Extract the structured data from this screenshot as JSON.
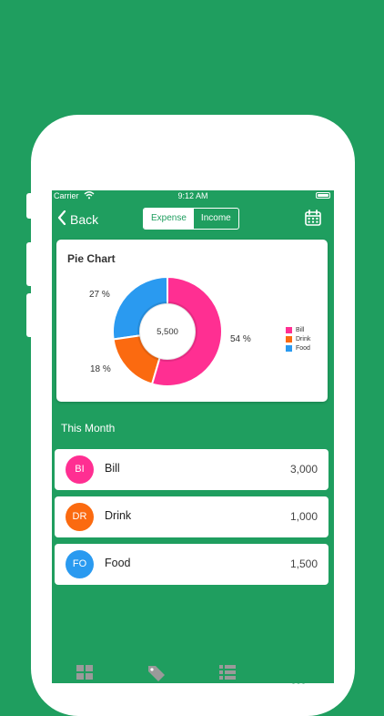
{
  "status_bar": {
    "carrier": "Carrier",
    "time": "9:12 AM"
  },
  "nav": {
    "back_label": "Back",
    "segments": [
      {
        "label": "Expense",
        "active": true
      },
      {
        "label": "Income",
        "active": false
      }
    ],
    "calendar_icon": "calendar-icon"
  },
  "pie_card": {
    "title": "Pie Chart",
    "center_total": "5,500"
  },
  "chart_data": {
    "type": "pie",
    "title": "Pie Chart",
    "categories": [
      "Bill",
      "Drink",
      "Food"
    ],
    "values": [
      3000,
      1000,
      1500
    ],
    "percent_labels": [
      "54 %",
      "18 %",
      "27 %"
    ],
    "colors": [
      "#ff2f92",
      "#fb6a10",
      "#2a9af0"
    ],
    "legend_position": "top-right"
  },
  "section_title": "This Month",
  "rows": [
    {
      "initials": "BI",
      "name": "Bill",
      "amount": "3,000",
      "color": "#ff2f92"
    },
    {
      "initials": "DR",
      "name": "Drink",
      "amount": "1,000",
      "color": "#fb6a10"
    },
    {
      "initials": "FO",
      "name": "Food",
      "amount": "1,500",
      "color": "#2a9af0"
    }
  ],
  "tab_icons": [
    "grid-icon",
    "tag-icon",
    "list-icon",
    "more-icon"
  ]
}
